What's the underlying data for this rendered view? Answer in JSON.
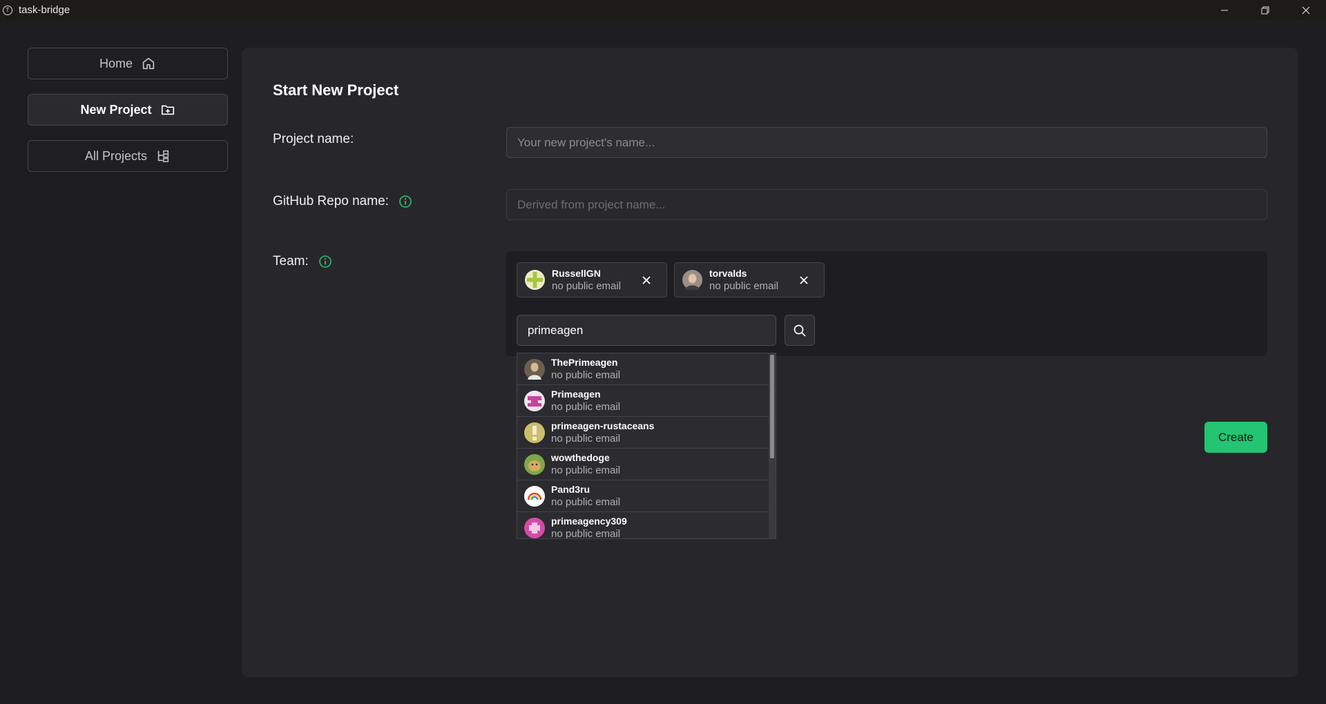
{
  "window": {
    "title": "task-bridge"
  },
  "sidebar": {
    "items": [
      {
        "label": "Home",
        "icon": "home-icon",
        "active": false
      },
      {
        "label": "New Project",
        "icon": "folder-plus-icon",
        "active": true
      },
      {
        "label": "All Projects",
        "icon": "tree-icon",
        "active": false
      }
    ]
  },
  "form": {
    "title": "Start New Project",
    "project_name_label": "Project name:",
    "project_name_placeholder": "Your new project's name...",
    "repo_label": "GitHub Repo name:",
    "repo_placeholder": "Derived from project name...",
    "team_label": "Team:",
    "team_members": [
      {
        "name": "RussellGN",
        "email": "no public email"
      },
      {
        "name": "torvalds",
        "email": "no public email"
      }
    ],
    "search_value": "primeagen",
    "search_results": [
      {
        "name": "ThePrimeagen",
        "email": "no public email"
      },
      {
        "name": "Primeagen",
        "email": "no public email"
      },
      {
        "name": "primeagen-rustaceans",
        "email": "no public email"
      },
      {
        "name": "wowthedoge",
        "email": "no public email"
      },
      {
        "name": "Pand3ru",
        "email": "no public email"
      },
      {
        "name": "primeagency309",
        "email": "no public email"
      }
    ],
    "create_label": "Create"
  },
  "colors": {
    "accent": "#23c472",
    "info_icon": "#2fbf6e",
    "background": "#1e1e21",
    "panel": "#27272b"
  }
}
